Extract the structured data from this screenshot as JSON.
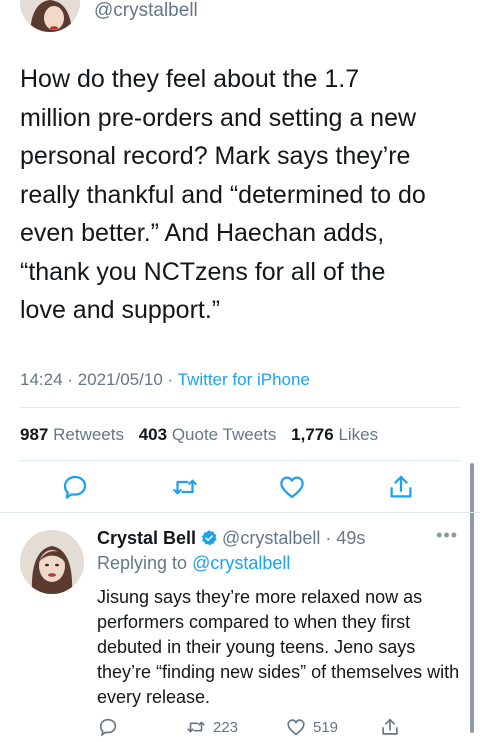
{
  "top": {
    "handle": "@crystalbell"
  },
  "tweet": {
    "text": "How do they feel about the 1.7\nmillion pre-orders and setting a new\npersonal record? Mark says they’re\nreally thankful and “determined to do\neven better.” And Haechan adds,\n“thank you NCTzens for all of the\nlove and support.”",
    "time": "14:24",
    "date": "2021/05/10",
    "separator": "·",
    "source": "Twitter for iPhone"
  },
  "stats": {
    "retweets_count": "987",
    "retweets_label": "Retweets",
    "quotes_count": "403",
    "quotes_label": "Quote Tweets",
    "likes_count": "1,776",
    "likes_label": "Likes"
  },
  "reply": {
    "name": "Crystal Bell",
    "handle": "@crystalbell",
    "age": "49s",
    "replying_label": "Replying to",
    "replying_to": "@crystalbell",
    "text": "Jisung says they’re more relaxed now as performers compared to when they first debuted in their young teens. Jeno says they’re “finding new sides” of themselves with every release.",
    "retweets": "223",
    "likes": "519"
  },
  "colors": {
    "accent": "#1da1f2",
    "muted": "#657786",
    "text": "#14171a"
  },
  "icons": [
    "reply-icon",
    "retweet-icon",
    "like-icon",
    "share-icon",
    "verified-badge-icon",
    "more-icon"
  ]
}
